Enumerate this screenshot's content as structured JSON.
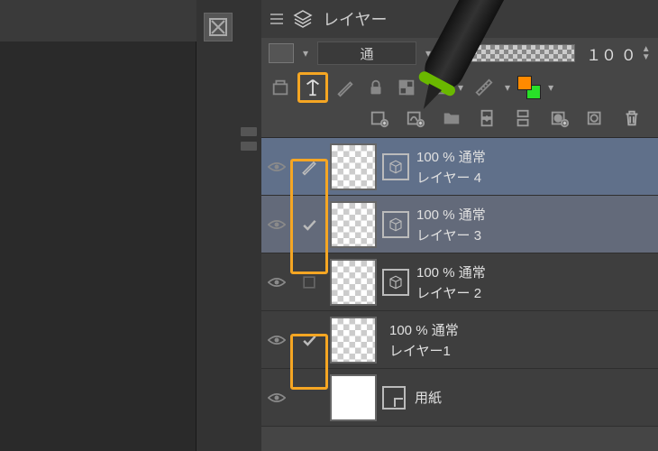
{
  "panel": {
    "title": "レイヤー",
    "blend_mode": "通",
    "opacity": "１０ ０",
    "icons": {
      "menu": "menu-icon",
      "stack": "layer-stack-icon",
      "ref": "reference-layer-icon",
      "lock": "lock-icon",
      "mask": "mask-icon",
      "ruler": "ruler-icon",
      "effect": "effect-icon",
      "colors": "color-swap-icon"
    }
  },
  "layers": [
    {
      "opacity_mode": "100 % 通常",
      "name": "レイヤー 4",
      "selected": true,
      "reference_target": true,
      "has_3d": true
    },
    {
      "opacity_mode": "100 % 通常",
      "name": "レイヤー 3",
      "selected": true,
      "reference_target": false,
      "has_3d": true
    },
    {
      "opacity_mode": "100 % 通常",
      "name": "レイヤー 2",
      "selected": false,
      "reference_target": false,
      "has_3d": true
    },
    {
      "opacity_mode": "100 % 通常",
      "name": "レイヤー1",
      "selected": false,
      "reference_target": false,
      "has_3d": false
    },
    {
      "opacity_mode": "",
      "name": "用紙",
      "selected": false,
      "reference_target": false,
      "has_3d": false
    }
  ]
}
